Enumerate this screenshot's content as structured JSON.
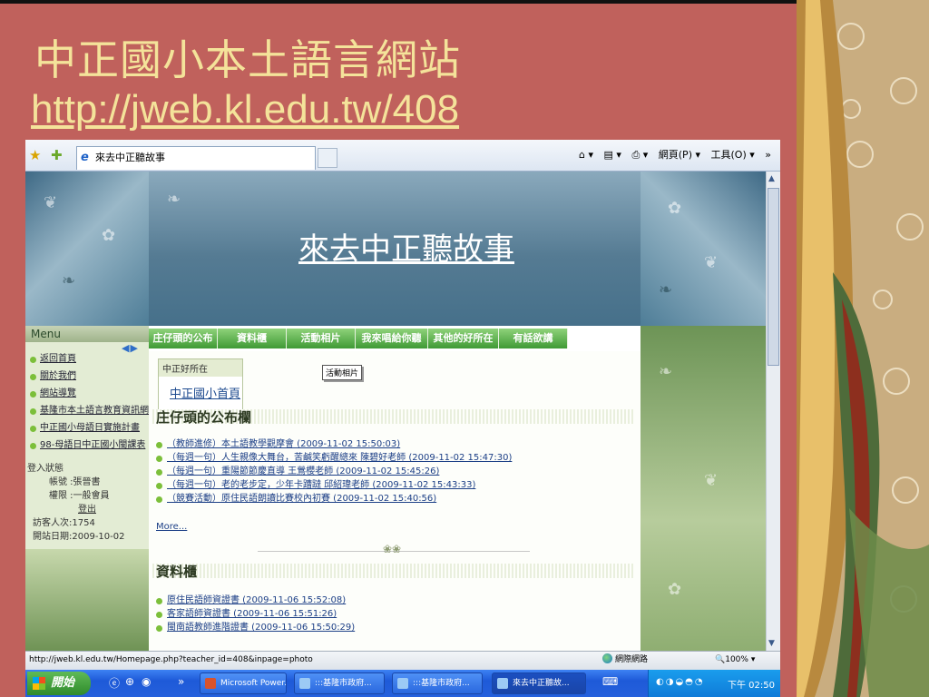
{
  "slide": {
    "title": "中正國小本土語言網站",
    "url": "http://jweb.kl.edu.tw/408"
  },
  "browser": {
    "tab_title": "來去中正聽故事",
    "commands": {
      "home": "⌂ ▾",
      "feeds": "▤ ▾",
      "print": "⎙ ▾",
      "page": "網頁(P) ▾",
      "tools": "工具(O) ▾",
      "more": "»"
    }
  },
  "site": {
    "title": "來去中正聽故事",
    "menu_header": "Menu",
    "menu_items": [
      "返回首頁",
      "關於我們",
      "網站導覽",
      "基隆市本土語言教育資訊網",
      "中正國小母語日實施計畫",
      "98-母語日中正國小閩課表"
    ],
    "login": {
      "header": "登入狀態",
      "account": "帳號 :張晉書",
      "permission": "權限 :一般會員",
      "logout": "登出",
      "visitors": "訪客人次:1754",
      "opened": "開站日期:2009-10-02"
    },
    "nav_tabs": [
      "庄仔頭的公布",
      "資料櫃",
      "活動相片",
      "我來唱給你聽",
      "其他的好所在",
      "有話欲講"
    ],
    "tooltip": "活動相片",
    "breadcrumb": {
      "header": "中正好所在",
      "link": "中正國小首頁"
    },
    "bulletin_title": "庄仔頭的公布欄",
    "bulletin_items": [
      "（教師進修）本土語教學觀摩會 (2009-11-02 15:50:03)",
      "（每週一句）人生親像大舞台，苦鹹笑虧醒總來 陳碧好老師 (2009-11-02 15:47:30)",
      "（每週一句）重陽節節慶直導 王鶯櫻老師 (2009-11-02 15:45:26)",
      "（每週一句）老的老步定，少年卡蹧躂 邱紹瑋老師 (2009-11-02 15:43:33)",
      "（競賽活動）原住民語朗讀比賽校內初賽 (2009-11-02 15:40:56)"
    ],
    "more": "More...",
    "cabinet_title": "資料櫃",
    "cabinet_items": [
      "原住民語師資證書 (2009-11-06 15:52:08)",
      "客家語師資證書 (2009-11-06 15:51:26)",
      "閩南語教師進階證書 (2009-11-06 15:50:29)"
    ]
  },
  "statusbar": {
    "url": "http://jweb.kl.edu.tw/Homepage.php?teacher_id=408&inpage=photo",
    "zone": "網際網路",
    "zoom": "100%"
  },
  "taskbar": {
    "start": "開始",
    "tasks": [
      "Microsoft Power...",
      ":::基隆市政府...",
      ":::基隆市政府...",
      "來去中正聽故..."
    ],
    "clock": "下午 02:50"
  }
}
